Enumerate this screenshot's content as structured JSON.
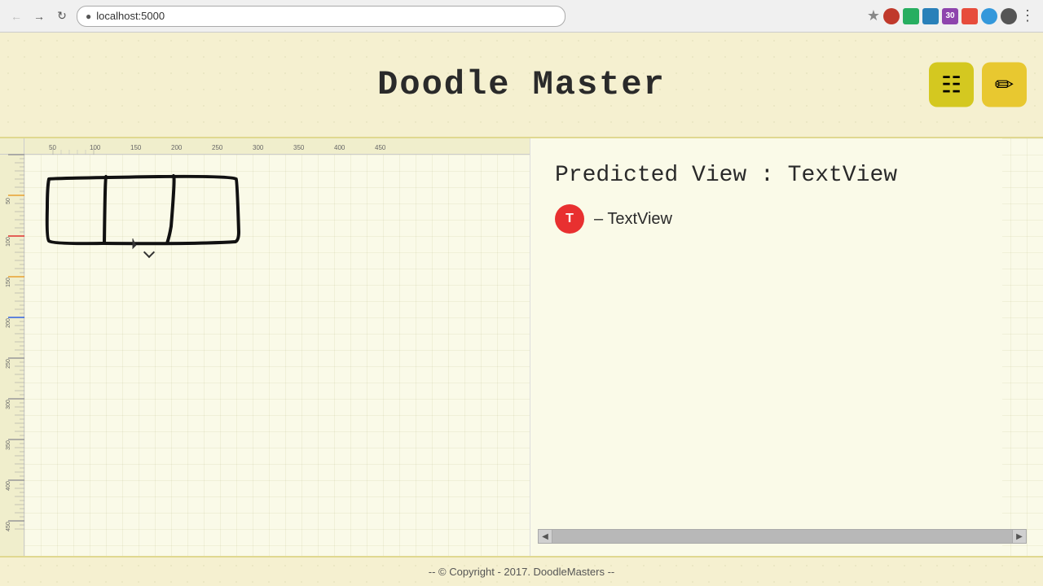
{
  "browser": {
    "url": "localhost:5000",
    "back_label": "←",
    "forward_label": "→",
    "refresh_label": "↻"
  },
  "header": {
    "title": "Doodle Master",
    "icon_grid_label": "⊞",
    "icon_eraser_label": "✏"
  },
  "main": {
    "predicted_view_label": "Predicted View : TextView",
    "prediction_badge_letter": "T",
    "prediction_text": "– TextView"
  },
  "footer": {
    "copyright": "-- © Copyright - 2017. DoodleMasters --"
  },
  "scrollbar": {
    "left_arrow": "◀",
    "right_arrow": "▶"
  }
}
